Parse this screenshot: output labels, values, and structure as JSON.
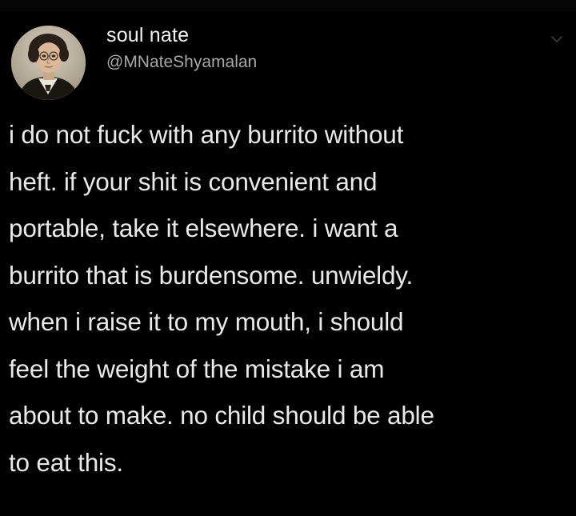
{
  "tweet": {
    "display_name": "soul nate",
    "handle": "@MNateShyamalan",
    "avatar_icon": "profile-portrait-avatar",
    "menu_icon": "chevron-down-icon",
    "text_lines": [
      "i do not fuck with any burrito without",
      "heft. if your shit is convenient and",
      "portable, take it elsewhere. i want a",
      "burrito that is burdensome. unwieldy.",
      "when i raise it to my mouth, i should",
      "feel the weight of the mistake i am",
      "about to make. no child should be able",
      "to eat this."
    ]
  },
  "colors": {
    "background": "#010101",
    "text_primary": "#e9e9e9",
    "text_secondary": "#a8a8a8",
    "caret": "#3c3c3c"
  }
}
